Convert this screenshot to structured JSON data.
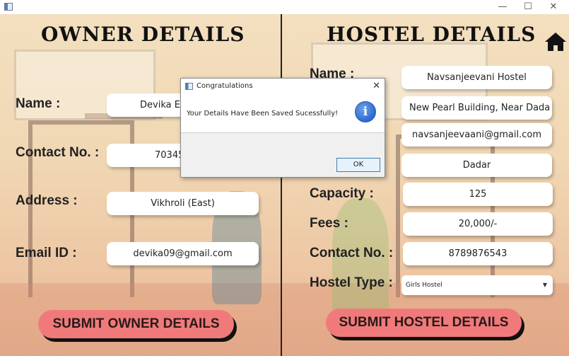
{
  "window": {
    "minimize_glyph": "—",
    "maximize_glyph": "☐",
    "close_glyph": "✕"
  },
  "owner": {
    "heading": "OWNER DETAILS",
    "labels": {
      "name": "Name :",
      "contact": "Contact No. :",
      "address": "Address :",
      "email": "Email ID :"
    },
    "values": {
      "name": "Devika Ep",
      "contact": "70345",
      "address": "Vikhroli (East)",
      "email": "devika09@gmail.com"
    },
    "submit_label": "SUBMIT OWNER DETAILS"
  },
  "hostel": {
    "heading": "HOSTEL DETAILS",
    "labels": {
      "name": "Name :",
      "capacity": "Capacity :",
      "fees": "Fees :",
      "contact": "Contact No. :",
      "type": "Hostel Type :"
    },
    "values": {
      "name": "Navsanjeevani Hostel",
      "address": "New Pearl Building, Near Dada",
      "email": "navsanjeevaani@gmail.com",
      "area": "Dadar",
      "capacity": "125",
      "fees": "20,000/-",
      "contact": "8789876543",
      "type": "Girls Hostel"
    },
    "submit_label": "SUBMIT HOSTEL DETAILS"
  },
  "dialog": {
    "title": "Congratulations",
    "message": "Your Details Have Been Saved Sucessfully!",
    "close_glyph": "✕",
    "info_glyph": "i",
    "ok_label": "OK"
  },
  "icons": {
    "home": "home-icon",
    "info": "info-icon"
  },
  "colors": {
    "submit_button": "#f07a7a",
    "dialog_ok_border": "#3c7fb1",
    "info_icon": "#2c6ad0"
  }
}
